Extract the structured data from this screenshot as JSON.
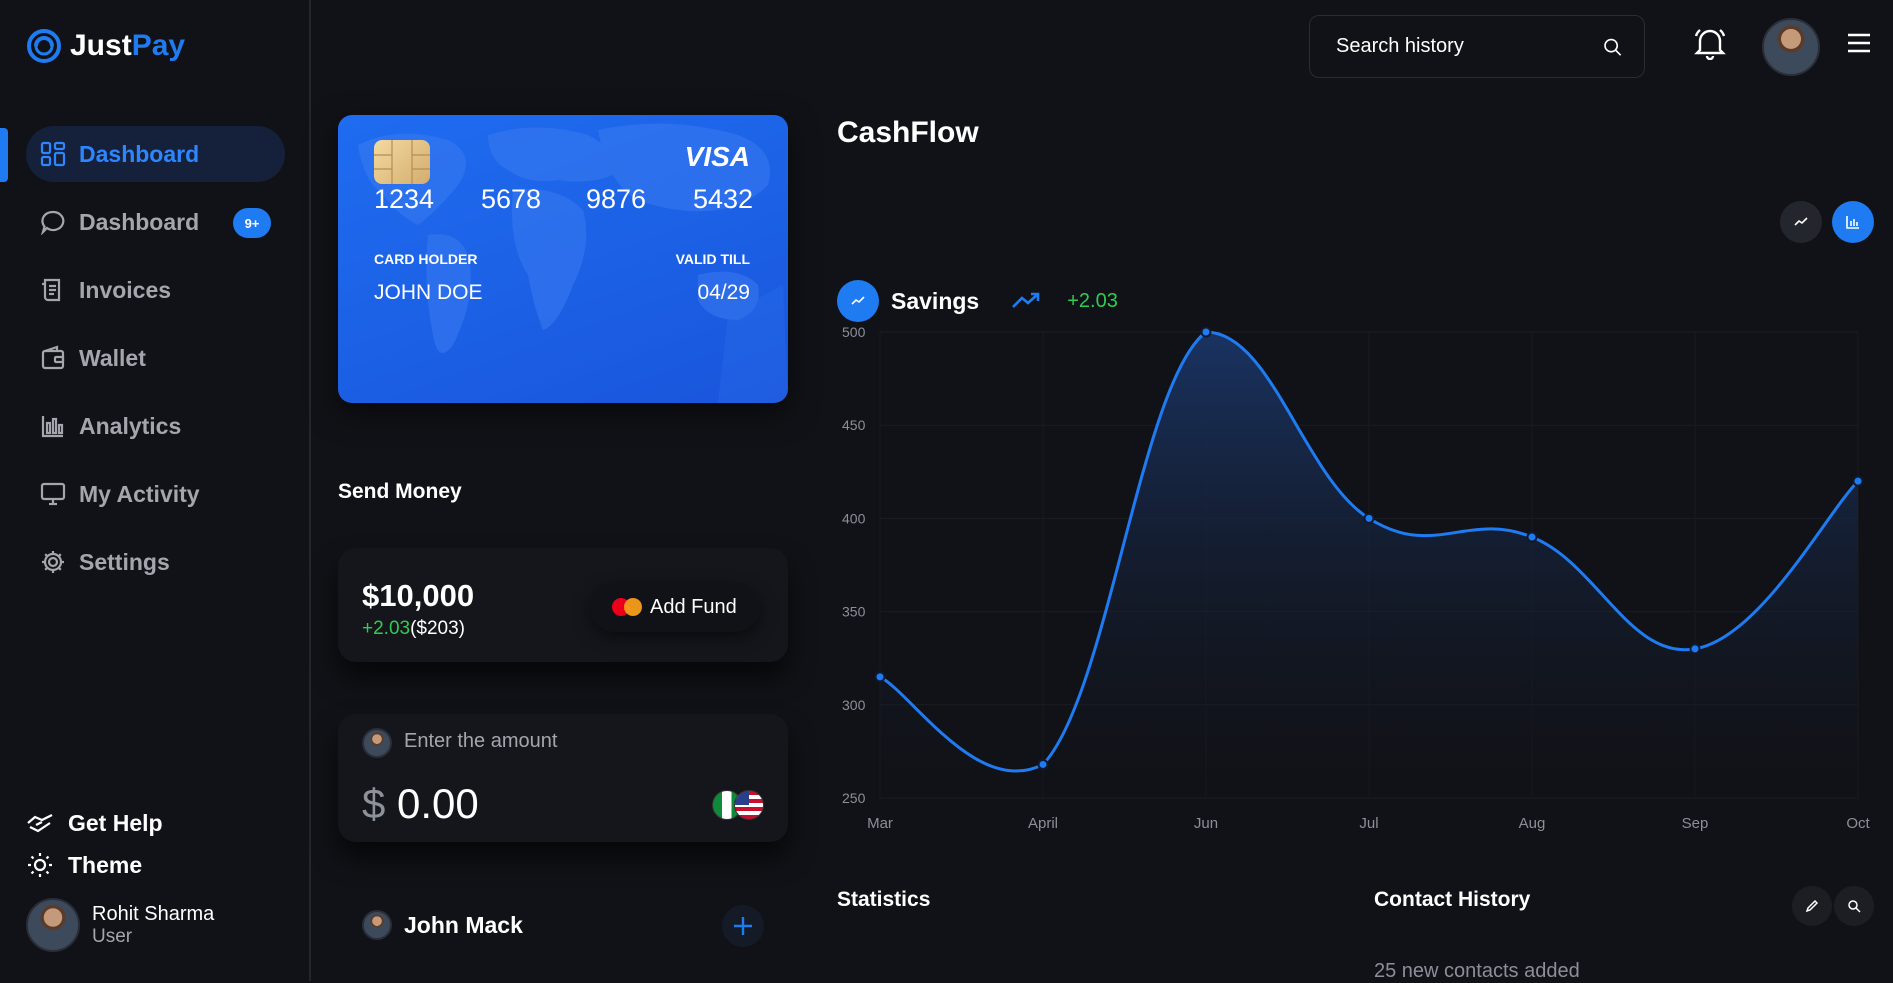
{
  "brand": {
    "name_part1": "Just",
    "name_part2": "Pay"
  },
  "sidebar": {
    "items": [
      {
        "label": "Dashboard",
        "icon": "grid-icon",
        "active": true
      },
      {
        "label": "Dashboard",
        "icon": "chat-icon",
        "badge": "9+"
      },
      {
        "label": "Invoices",
        "icon": "receipt-icon"
      },
      {
        "label": "Wallet",
        "icon": "wallet-icon"
      },
      {
        "label": "Analytics",
        "icon": "bar-chart-icon"
      },
      {
        "label": "My Activity",
        "icon": "monitor-icon"
      },
      {
        "label": "Settings",
        "icon": "gear-icon"
      }
    ],
    "help_label": "Get Help",
    "theme_label": "Theme",
    "user": {
      "name": "Rohit Sharma",
      "role": "User"
    }
  },
  "header": {
    "search_placeholder": "Search history"
  },
  "card": {
    "numbers": [
      "1234",
      "5678",
      "9876",
      "5432"
    ],
    "brand": "VISA",
    "holder_label": "CARD HOLDER",
    "holder_name": "JOHN DOE",
    "valid_label": "VALID TILL",
    "valid_value": "04/29",
    "colors": {
      "card": "#1f6cf0",
      "chip": "#e6c489"
    }
  },
  "send_money": {
    "title": "Send Money",
    "balance": "$10,000",
    "change_pct": "+2.03",
    "change_amount": "($203)",
    "add_fund_label": "Add Fund",
    "amount_label": "Enter the amount",
    "currency_symbol": "$",
    "amount_value": "0.00",
    "contact_name": "John Mack"
  },
  "cashflow": {
    "title": "CashFlow",
    "series_label": "Savings",
    "series_change": "+2.03"
  },
  "chart_data": {
    "type": "area",
    "x": [
      "Mar",
      "April",
      "Jun",
      "Jul",
      "Aug",
      "Sep",
      "Oct"
    ],
    "series": [
      {
        "name": "Savings",
        "values": [
          315,
          268,
          500,
          400,
          390,
          330,
          420
        ]
      }
    ],
    "yticks": [
      250,
      300,
      350,
      400,
      450,
      500
    ],
    "ylim": [
      250,
      500
    ],
    "grid": true,
    "color": "#1f7bf2"
  },
  "statistics": {
    "title": "Statistics"
  },
  "contact_history": {
    "title": "Contact History",
    "subtitle": "25 new contacts added"
  },
  "colors": {
    "accent": "#1f7bf2",
    "background": "#111217",
    "positive": "#2ecc52",
    "muted": "#a3a6ad"
  }
}
